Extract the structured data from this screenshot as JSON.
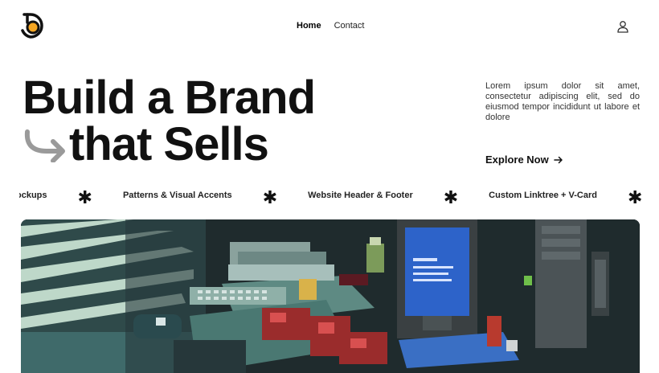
{
  "brand": {
    "logo_icon": "d-logo-icon"
  },
  "nav": {
    "items": [
      {
        "label": "Home",
        "active": true
      },
      {
        "label": "Contact",
        "active": false
      }
    ],
    "user_icon": "user-icon"
  },
  "hero": {
    "title_line1": "Build a Brand",
    "title_line2": "that Sells",
    "arrow_icon": "curved-arrow-icon",
    "description": "Lorem ipsum dolor sit amet, consectetur adipiscing elit, sed do eiusmod tempor incididunt ut labore et dolore",
    "cta_label": "Explore Now",
    "cta_icon": "arrow-right-icon"
  },
  "marquee": {
    "items": [
      "ockups",
      "Patterns & Visual Accents",
      "Website Header & Footer",
      "Custom Linktree + V-Card"
    ],
    "separator": "✱"
  },
  "colors": {
    "logo_accent": "#f5a623",
    "text": "#111111",
    "image_bg": "#1d2b2f"
  }
}
